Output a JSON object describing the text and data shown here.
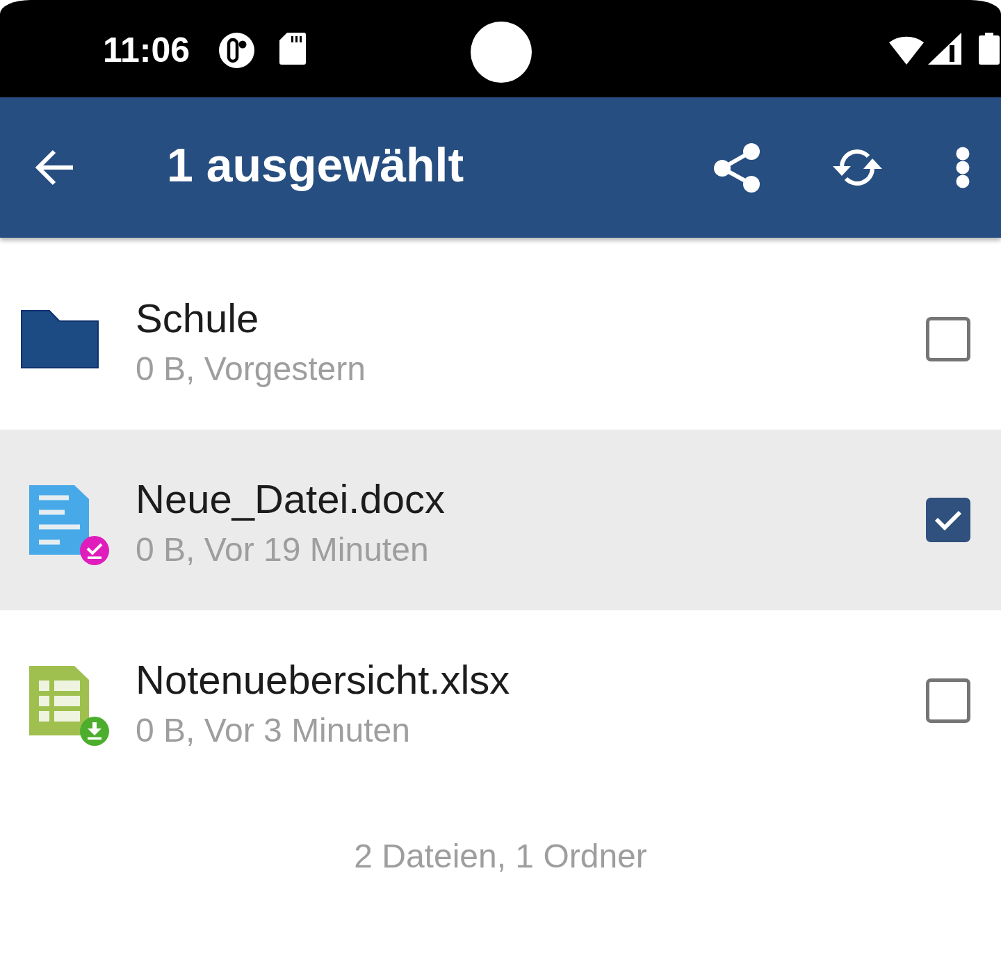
{
  "status_bar": {
    "time": "11:06"
  },
  "toolbar": {
    "title": "1 ausgewählt"
  },
  "files": [
    {
      "kind": "folder",
      "name": "Schule",
      "details": "0 B, Vorgestern",
      "selected": false,
      "available_offline": false,
      "downloaded": false
    },
    {
      "kind": "document",
      "name": "Neue_Datei.docx",
      "details": "0 B, Vor 19 Minuten",
      "selected": true,
      "available_offline": true,
      "downloaded": false
    },
    {
      "kind": "spreadsheet",
      "name": "Notenuebersicht.xlsx",
      "details": "0 B, Vor 3 Minuten",
      "selected": false,
      "available_offline": false,
      "downloaded": true
    }
  ],
  "summary": "2 Dateien, 1 Ordner"
}
